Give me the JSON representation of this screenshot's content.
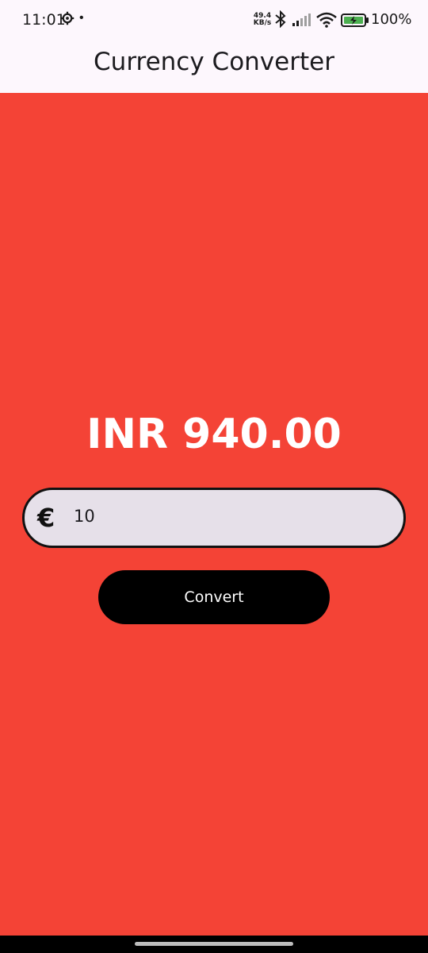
{
  "status_bar": {
    "time": "11:01",
    "dot": "•",
    "speed_value": "49.4",
    "speed_unit": "KB/s",
    "battery_text": "100%",
    "icons": [
      "gear-icon",
      "bluetooth-icon",
      "signal-icon",
      "wifi-icon",
      "battery-charging-icon"
    ]
  },
  "app_bar": {
    "title": "Currency Converter"
  },
  "main": {
    "background_color": "#f44336",
    "result_text": "INR 940.00",
    "input": {
      "icon": "euro-icon",
      "icon_glyph": "€",
      "value": "10"
    },
    "convert_label": "Convert"
  }
}
